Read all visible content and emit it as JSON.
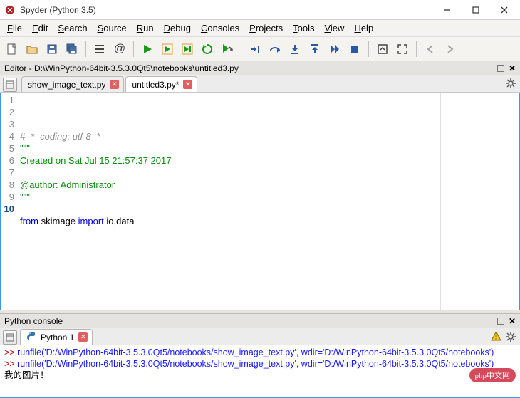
{
  "title": "Spyder (Python 3.5)",
  "menus": [
    "File",
    "Edit",
    "Search",
    "Source",
    "Run",
    "Debug",
    "Consoles",
    "Projects",
    "Tools",
    "View",
    "Help"
  ],
  "crumb_label": "Editor - ",
  "crumb_path": "D:\\WinPython-64bit-3.5.3.0Qt5\\notebooks\\untitled3.py",
  "tabs": [
    {
      "label": "show_image_text.py",
      "dirty": false,
      "active": false
    },
    {
      "label": "untitled3.py*",
      "dirty": true,
      "active": true
    }
  ],
  "code": {
    "lines": [
      {
        "n": 1,
        "seg": [
          {
            "cls": "c-comment",
            "t": "# -*- coding: utf-8 -*-"
          }
        ]
      },
      {
        "n": 2,
        "seg": [
          {
            "cls": "c-str",
            "t": "\"\"\""
          }
        ]
      },
      {
        "n": 3,
        "seg": [
          {
            "cls": "c-str",
            "t": "Created on Sat Jul 15 21:57:37 2017"
          }
        ]
      },
      {
        "n": 4,
        "seg": [
          {
            "cls": "c-str",
            "t": ""
          }
        ]
      },
      {
        "n": 5,
        "seg": [
          {
            "cls": "c-str",
            "t": "@author: Administrator"
          }
        ]
      },
      {
        "n": 6,
        "seg": [
          {
            "cls": "c-str",
            "t": "\"\"\""
          }
        ]
      },
      {
        "n": 7,
        "seg": [
          {
            "cls": "c-plain",
            "t": ""
          }
        ]
      },
      {
        "n": 8,
        "seg": [
          {
            "cls": "c-kw",
            "t": "from "
          },
          {
            "cls": "c-plain",
            "t": "skimage "
          },
          {
            "cls": "c-kw",
            "t": "import "
          },
          {
            "cls": "c-plain",
            "t": "io,data"
          }
        ]
      },
      {
        "n": 9,
        "seg": [
          {
            "cls": "c-plain",
            "t": ""
          }
        ]
      },
      {
        "n": 10,
        "seg": [
          {
            "cls": "c-plain",
            "t": ""
          }
        ]
      }
    ],
    "current_line": 10
  },
  "python_console": {
    "title": "Python console",
    "tab": "Python 1",
    "lines": [
      {
        "prompt": ">> ",
        "run": "runfile('D:/WinPython-64bit-3.5.3.0Qt5/notebooks/show_image_text.py', wdir='D:/WinPython-64bit-3.5.3.0Qt5/notebooks')"
      },
      {
        "prompt": ">> ",
        "run": "runfile('D:/WinPython-64bit-3.5.3.0Qt5/notebooks/show_image_text.py', wdir='D:/WinPython-64bit-3.5.3.0Qt5/notebooks')"
      },
      {
        "out": "我的图片！"
      }
    ]
  },
  "watermark": "php中文网"
}
